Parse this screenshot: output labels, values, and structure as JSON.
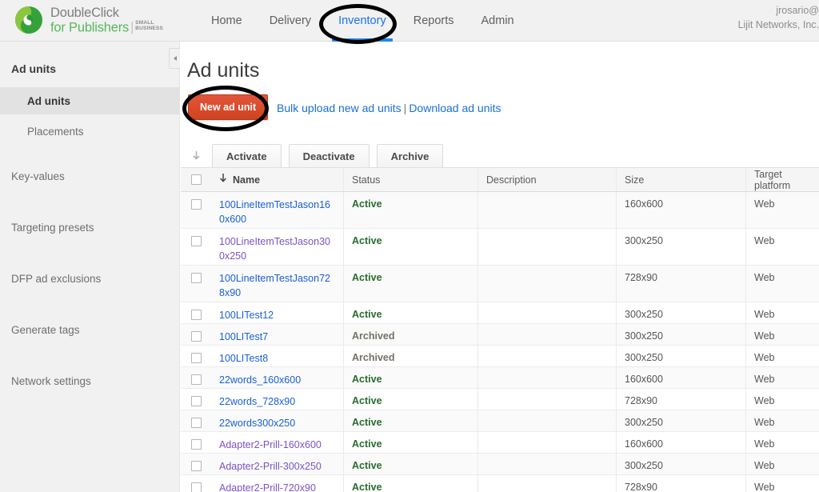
{
  "brand": {
    "line1": "DoubleClick",
    "line2": "for Publishers",
    "separator": "|",
    "badge_line1": "SMALL",
    "badge_line2": "BUSINESS",
    "logo_icon": "doubleclick-swirl-logo",
    "green": "#57b85c"
  },
  "nav": {
    "items": [
      {
        "label": "Home",
        "active": false
      },
      {
        "label": "Delivery",
        "active": false
      },
      {
        "label": "Inventory",
        "active": true
      },
      {
        "label": "Reports",
        "active": false
      },
      {
        "label": "Admin",
        "active": false
      }
    ],
    "active_color": "#1a73e8"
  },
  "user": {
    "account": "jrosario@",
    "network": "Lijit Networks, Inc."
  },
  "sidebar": {
    "group_title": "Ad units",
    "sub_items": [
      {
        "label": "Ad units",
        "selected": true
      },
      {
        "label": "Placements",
        "selected": false
      }
    ],
    "links": [
      {
        "label": "Key-values"
      },
      {
        "label": "Targeting presets"
      },
      {
        "label": "DFP ad exclusions"
      },
      {
        "label": "Generate tags"
      },
      {
        "label": "Network settings"
      }
    ],
    "collapse_icon": "chevron-left-icon"
  },
  "main": {
    "page_title": "Ad units",
    "new_button": "New ad unit",
    "bulk_upload_link": "Bulk upload new ad units",
    "link_separator": "|",
    "download_link": "Download ad units",
    "new_button_color": "#d0431f"
  },
  "toolbar": {
    "download_icon": "download-arrow-icon",
    "buttons": [
      {
        "label": "Activate"
      },
      {
        "label": "Deactivate"
      },
      {
        "label": "Archive"
      }
    ]
  },
  "table": {
    "sort_icon": "arrow-down-icon",
    "select_all_checkbox": "unchecked",
    "columns": [
      {
        "key": "name",
        "label": "Name",
        "sorted": true
      },
      {
        "key": "status",
        "label": "Status"
      },
      {
        "key": "description",
        "label": "Description"
      },
      {
        "key": "size",
        "label": "Size"
      },
      {
        "key": "platform",
        "label": "Target platform"
      }
    ],
    "rows": [
      {
        "name": "100LineItemTestJason160x600",
        "status": "Active",
        "description": "",
        "size": "160x600",
        "platform": "Web",
        "visited": false,
        "tall": true
      },
      {
        "name": "100LineItemTestJason300x250",
        "status": "Active",
        "description": "",
        "size": "300x250",
        "platform": "Web",
        "visited": true,
        "tall": true
      },
      {
        "name": "100LineItemTestJason728x90",
        "status": "Active",
        "description": "",
        "size": "728x90",
        "platform": "Web",
        "visited": false,
        "tall": true
      },
      {
        "name": "100LITest12",
        "status": "Active",
        "description": "",
        "size": "300x250",
        "platform": "Web",
        "visited": false,
        "tall": false
      },
      {
        "name": "100LITest7",
        "status": "Archived",
        "description": "",
        "size": "300x250",
        "platform": "Web",
        "visited": false,
        "tall": false
      },
      {
        "name": "100LITest8",
        "status": "Archived",
        "description": "",
        "size": "300x250",
        "platform": "Web",
        "visited": false,
        "tall": false
      },
      {
        "name": "22words_160x600",
        "status": "Active",
        "description": "",
        "size": "160x600",
        "platform": "Web",
        "visited": false,
        "tall": false
      },
      {
        "name": "22words_728x90",
        "status": "Active",
        "description": "",
        "size": "728x90",
        "platform": "Web",
        "visited": false,
        "tall": false
      },
      {
        "name": "22words300x250",
        "status": "Active",
        "description": "",
        "size": "300x250",
        "platform": "Web",
        "visited": false,
        "tall": false
      },
      {
        "name": "Adapter2-Prill-160x600",
        "status": "Active",
        "description": "",
        "size": "160x600",
        "platform": "Web",
        "visited": true,
        "tall": false
      },
      {
        "name": "Adapter2-Prill-300x250",
        "status": "Active",
        "description": "",
        "size": "300x250",
        "platform": "Web",
        "visited": true,
        "tall": false
      },
      {
        "name": "Adapter2-Prill-720x90",
        "status": "Active",
        "description": "",
        "size": "728x90",
        "platform": "Web",
        "visited": true,
        "tall": false
      }
    ]
  },
  "annotations": {
    "ellipse_color": "#000000",
    "highlights": [
      {
        "target": "inventory-nav-item"
      },
      {
        "target": "new-ad-unit-button"
      }
    ]
  }
}
